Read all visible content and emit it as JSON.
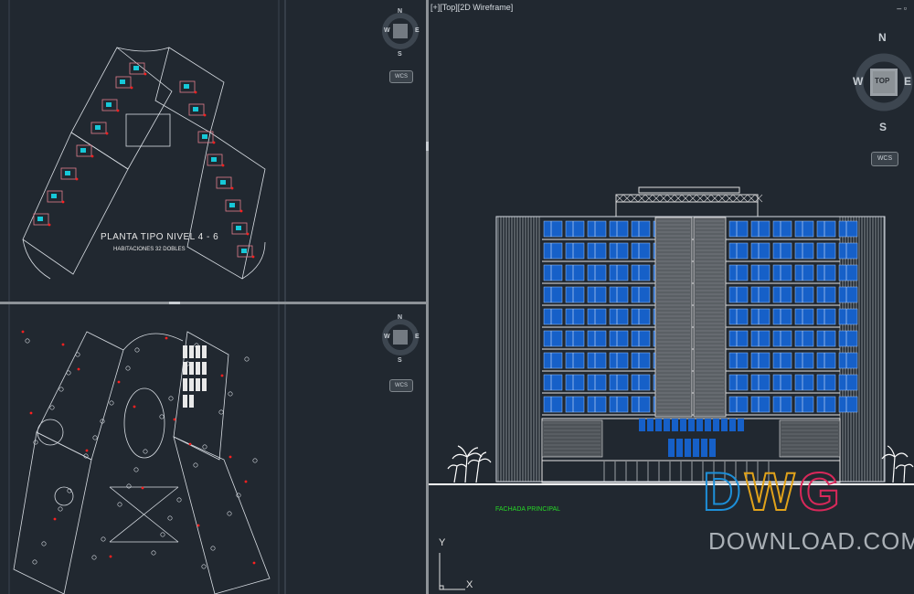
{
  "viewports": {
    "right": {
      "label": "[+][Top][2D Wireframe]",
      "controls": "– ▫"
    },
    "viewcube_main": {
      "n": "N",
      "s": "S",
      "e": "E",
      "w": "W",
      "face": "TOP",
      "wcs": "WCS"
    },
    "viewcube_small": {
      "n": "N",
      "s": "S",
      "e": "E",
      "w": "W",
      "wcs": "WCS"
    }
  },
  "drawing": {
    "plan_title": "PLANTA TIPO NIVEL 4 - 6",
    "plan_subtitle": "HABITACIONES 32 DOBLES",
    "elevation_label": "FACHADA PRINCIPAL"
  },
  "ucs": {
    "y": "Y",
    "x": "X"
  },
  "watermark": {
    "letters": [
      "D",
      "W",
      "G"
    ],
    "colors": [
      "#1d8fd8",
      "#e0a21a",
      "#d8285a"
    ],
    "subtitle": "DOWNLOAD.COM"
  }
}
